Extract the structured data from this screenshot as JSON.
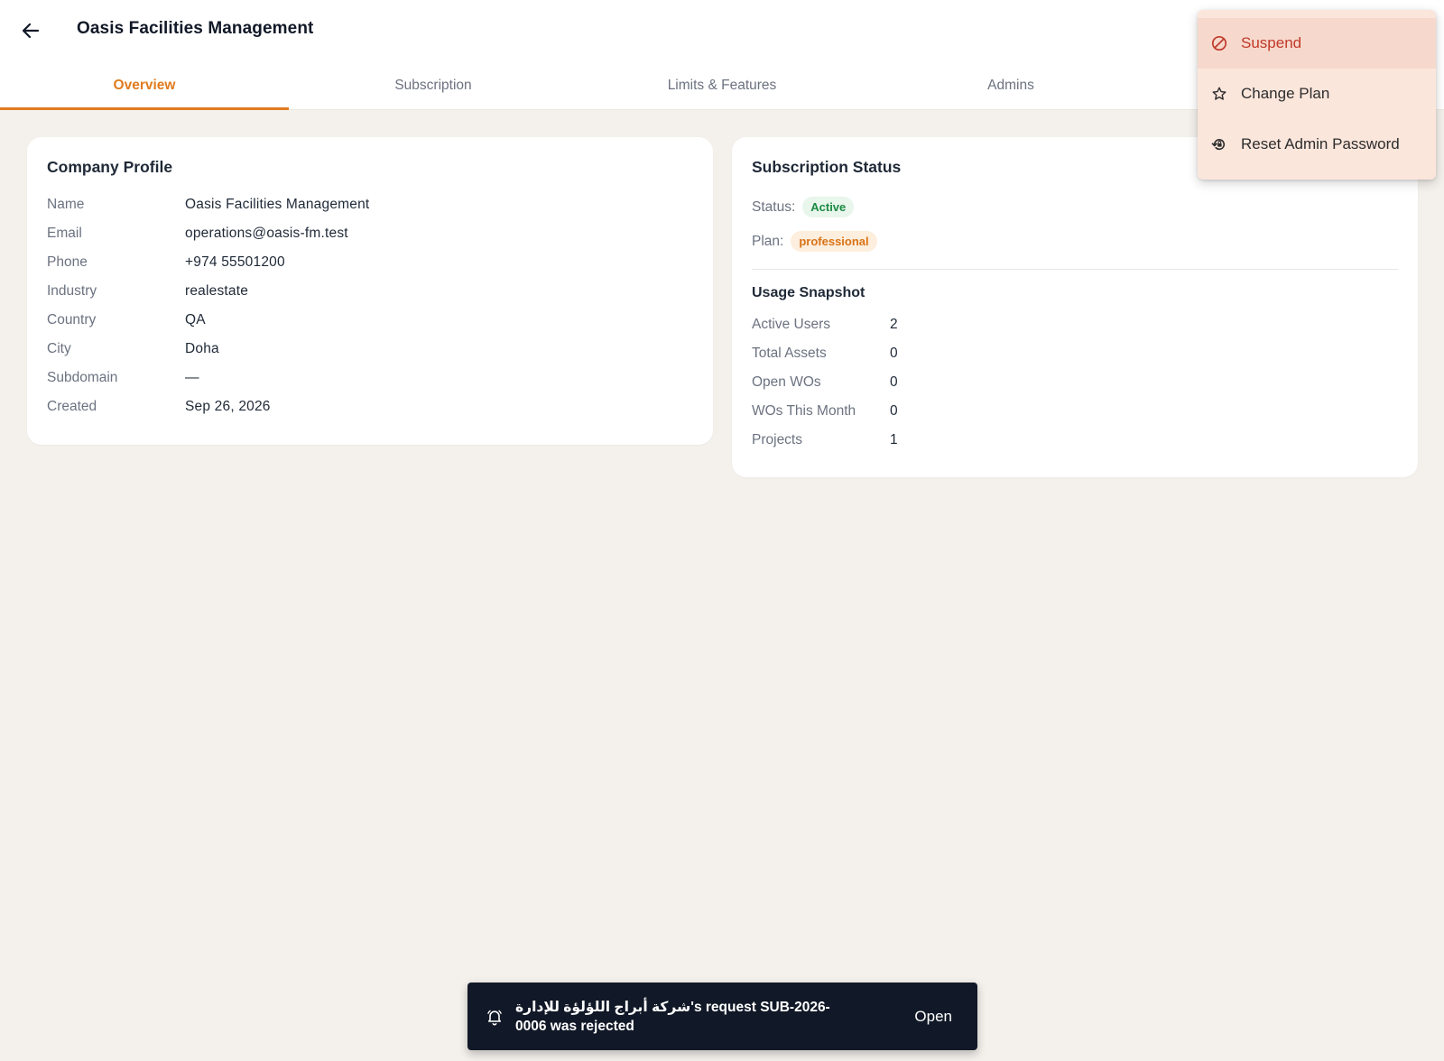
{
  "header": {
    "title": "Oasis Facilities Management",
    "back_icon": "arrow-left-icon"
  },
  "tabs": [
    {
      "label": "Overview",
      "active": true
    },
    {
      "label": "Subscription",
      "active": false
    },
    {
      "label": "Limits & Features",
      "active": false
    },
    {
      "label": "Admins",
      "active": false
    }
  ],
  "profile": {
    "title": "Company Profile",
    "fields": [
      {
        "label": "Name",
        "value": "Oasis Facilities Management"
      },
      {
        "label": "Email",
        "value": "operations@oasis-fm.test"
      },
      {
        "label": "Phone",
        "value": "+974 55501200"
      },
      {
        "label": "Industry",
        "value": "realestate"
      },
      {
        "label": "Country",
        "value": "QA"
      },
      {
        "label": "City",
        "value": "Doha"
      },
      {
        "label": "Subdomain",
        "value": "—"
      },
      {
        "label": "Created",
        "value": "Sep 26, 2026"
      }
    ]
  },
  "subscription": {
    "title": "Subscription Status",
    "status_label": "Status:",
    "status_value": "Active",
    "plan_label": "Plan:",
    "plan_value": "professional",
    "usage_title": "Usage Snapshot",
    "usage": [
      {
        "label": "Active Users",
        "value": "2"
      },
      {
        "label": "Total Assets",
        "value": "0"
      },
      {
        "label": "Open WOs",
        "value": "0"
      },
      {
        "label": "WOs This Month",
        "value": "0"
      },
      {
        "label": "Projects",
        "value": "1"
      }
    ]
  },
  "menu": {
    "items": [
      {
        "label": "Suspend",
        "icon": "ban-icon"
      },
      {
        "label": "Change Plan",
        "icon": "star-icon"
      },
      {
        "label": "Reset Admin Password",
        "icon": "lock-reset-icon"
      }
    ]
  },
  "toast": {
    "icon": "bell-icon",
    "message": "شركة أبراج اللؤلؤة للإدارة's request SUB-2026-0006 was rejected",
    "action": "Open"
  },
  "colors": {
    "accent": "#e07b1f",
    "background": "#f4f0ec",
    "danger": "#c0392b",
    "success": "#1c8a43",
    "toast_bg": "#111827"
  }
}
